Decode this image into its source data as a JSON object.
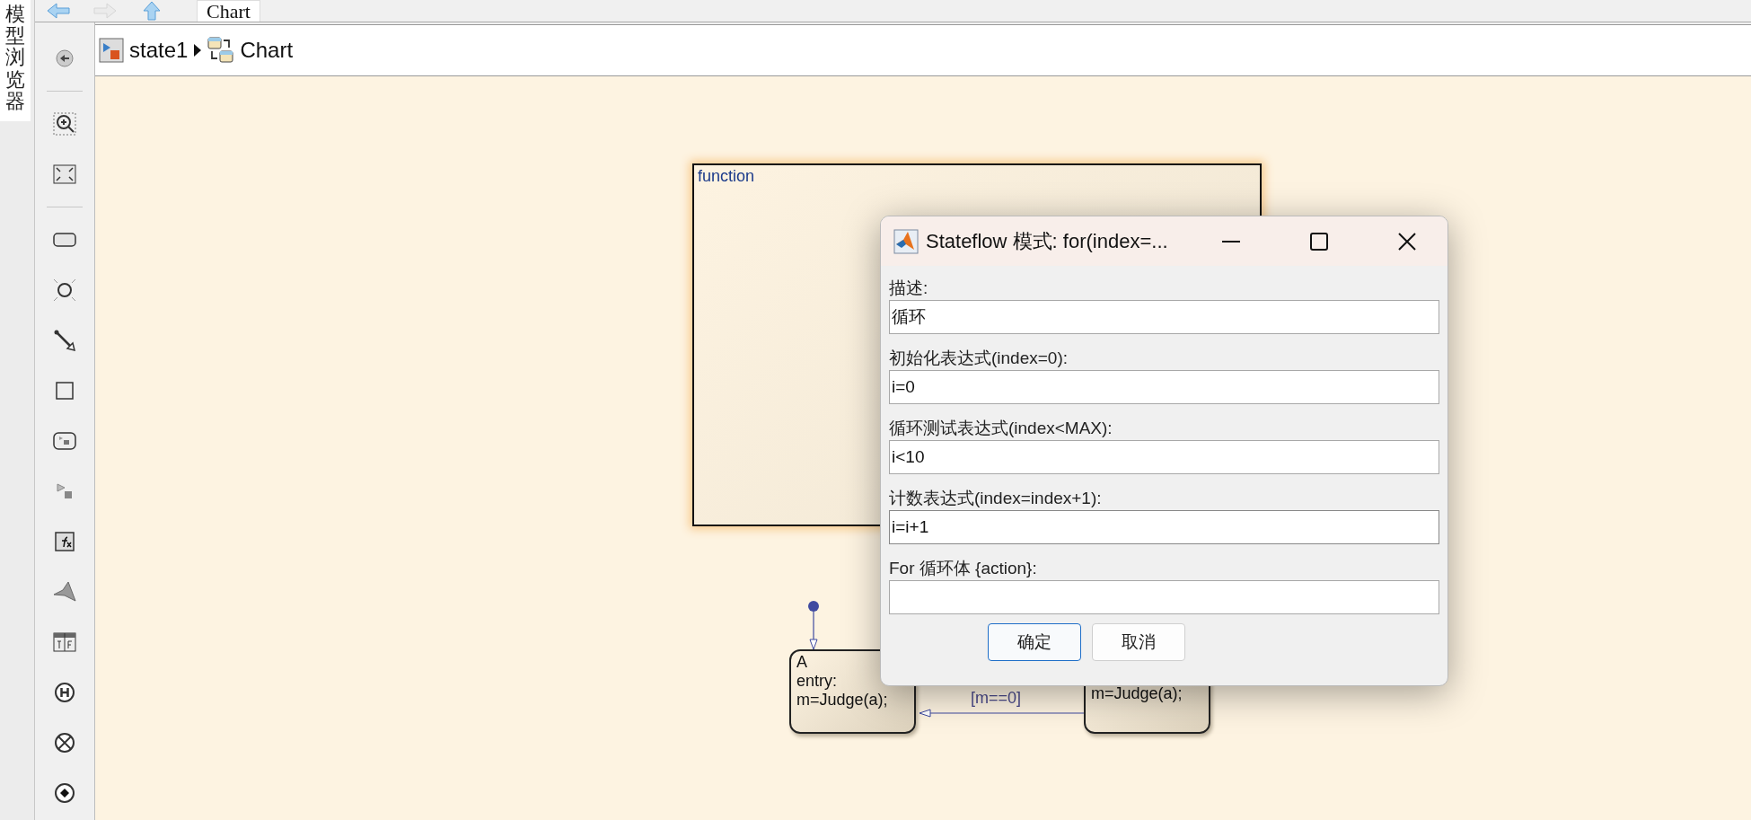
{
  "side_tab": {
    "label": "模型浏览器"
  },
  "nav": {
    "buttons": [
      {
        "kind": "back",
        "disabled": false
      },
      {
        "kind": "forward",
        "disabled": true
      },
      {
        "kind": "up",
        "disabled": false
      }
    ],
    "tab": "Chart"
  },
  "breadcrumb": [
    {
      "label": "state1",
      "kind": "model"
    },
    {
      "label": "Chart",
      "kind": "chart"
    }
  ],
  "palette": [
    {
      "kind": "back"
    },
    {
      "kind": "sep"
    },
    {
      "kind": "zoom"
    },
    {
      "kind": "fit"
    },
    {
      "kind": "sep"
    },
    {
      "kind": "state"
    },
    {
      "kind": "junction"
    },
    {
      "kind": "transition"
    },
    {
      "kind": "box"
    },
    {
      "kind": "subchart"
    },
    {
      "kind": "simulink"
    },
    {
      "kind": "function"
    },
    {
      "kind": "matlab"
    },
    {
      "kind": "truth"
    },
    {
      "kind": "history"
    },
    {
      "kind": "exit"
    },
    {
      "kind": "entry"
    }
  ],
  "canvas": {
    "function_box": {
      "label": "function"
    },
    "states": [
      {
        "lines": [
          "A",
          "entry:",
          "m=Judge(a);"
        ]
      },
      {
        "lines": [
          "m=Judge(a);"
        ]
      }
    ],
    "transition": {
      "label": "[m==0]"
    }
  },
  "dialog": {
    "title": "Stateflow 模式: for(index=...",
    "fields": [
      {
        "label": "描述:",
        "value": "循环"
      },
      {
        "label": "初始化表达式(index=0):",
        "value": "i=0"
      },
      {
        "label": "循环测试表达式(index<MAX):",
        "value": "i<10"
      },
      {
        "label": "计数表达式(index=index+1):",
        "value": "i=i+1",
        "focused": true
      },
      {
        "label": "For 循环体 {action}:"
      }
    ],
    "buttons": [
      {
        "label": "确定",
        "default": true
      },
      {
        "label": "取消",
        "default": false
      }
    ]
  }
}
